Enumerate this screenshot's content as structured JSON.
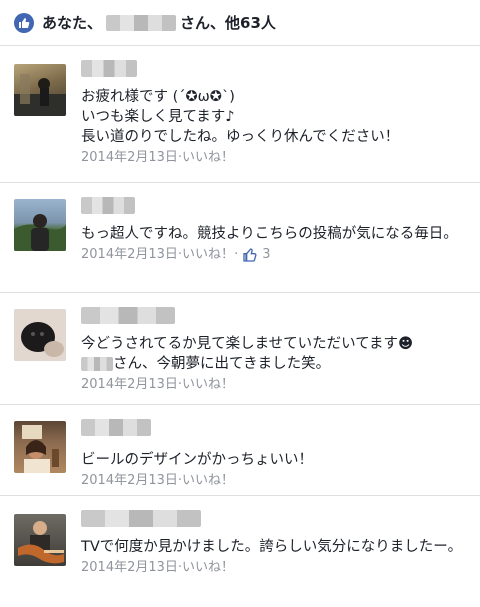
{
  "likes_bar": {
    "prefix": "あなた、",
    "suffix": "さん、他63人"
  },
  "comments": [
    {
      "text": "お疲れ様です (´✪ω✪`)\nいつも楽しく見てます♪\n長い道のりでしたね。ゆっくり休んでください！",
      "date": "2014年2月13日",
      "sep": " · ",
      "like_label": "いいね！"
    },
    {
      "text": "もっ超人ですね。競技よりこちらの投稿が気になる毎日。",
      "date": "2014年2月13日",
      "sep": " · ",
      "like_label": "いいね！",
      "sep2": " · ",
      "like_count": "3"
    },
    {
      "text": "今どうされてるか見て楽しませていただいてます☻",
      "text2": "さん、今朝夢に出てきました笑。",
      "date": "2014年2月13日",
      "sep": " · ",
      "like_label": "いいね！"
    },
    {
      "text": "ビールのデザインがかっちょいい！",
      "date": "2014年2月13日",
      "sep": " · ",
      "like_label": "いいね！"
    },
    {
      "text": "TVで何度か見かけました。誇らしい気分になりましたー。",
      "date": "2014年2月13日",
      "sep": " · ",
      "like_label": "いいね！"
    }
  ],
  "icons": {
    "likes_bar": "thumbs-up-icon",
    "like_count": "thumbs-up-outline-icon"
  }
}
